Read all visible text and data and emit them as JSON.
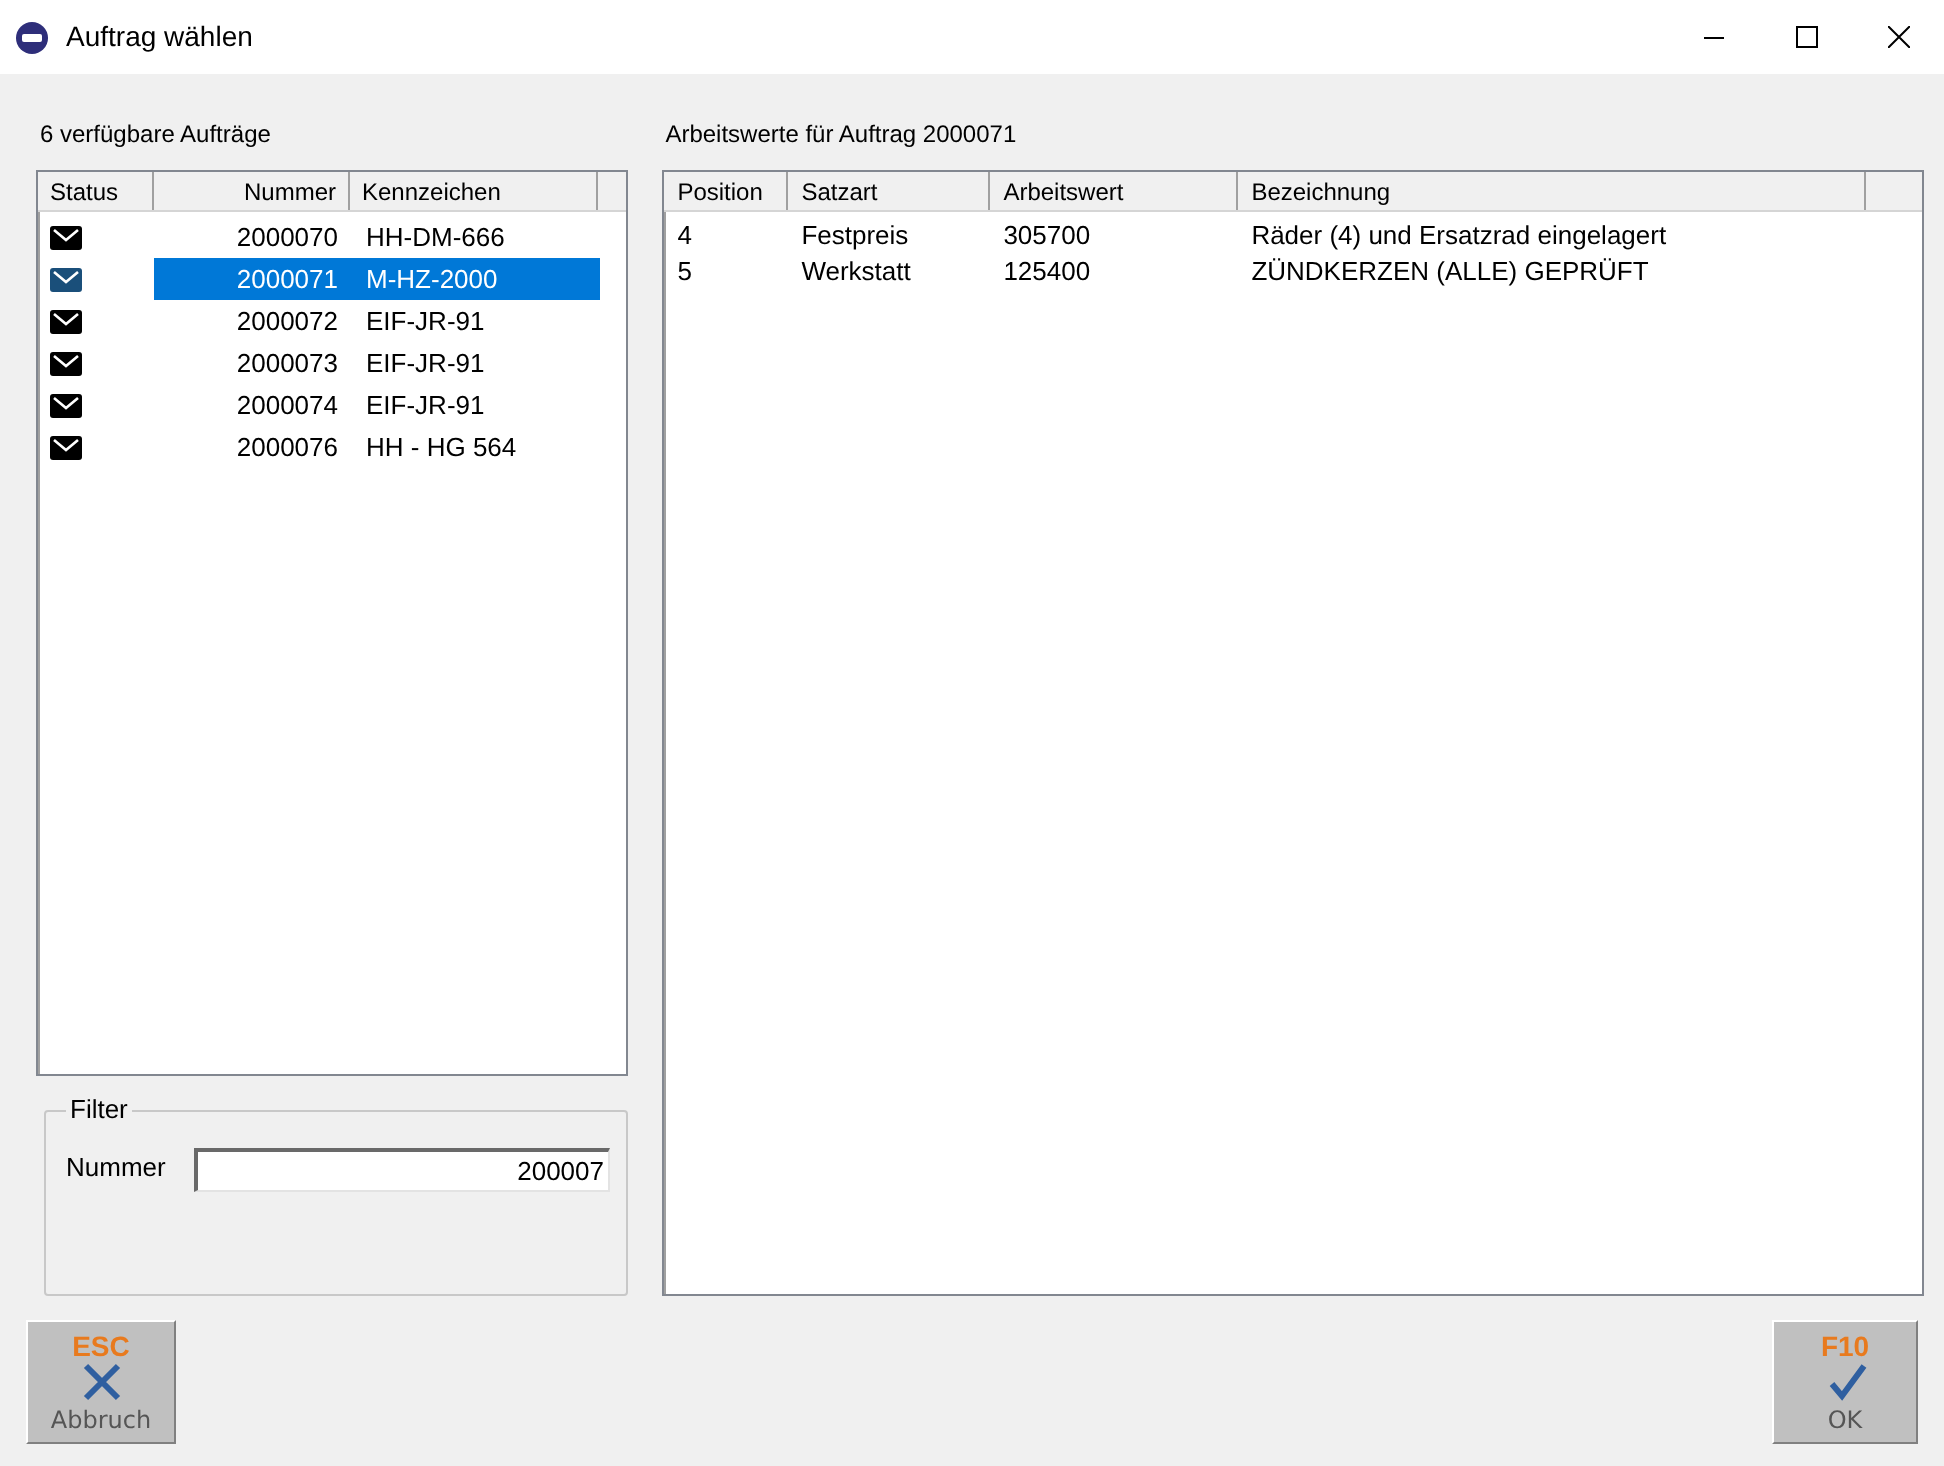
{
  "window": {
    "title": "Auftrag wählen"
  },
  "orders": {
    "heading": "6 verfügbare Aufträge",
    "columns": [
      "Status",
      "Nummer",
      "Kennzeichen"
    ],
    "rows": [
      {
        "kind": "mail",
        "nummer": "2000070",
        "kennzeichen": "HH-DM-666",
        "selected": false
      },
      {
        "kind": "mail",
        "nummer": "2000071",
        "kennzeichen": "M-HZ-2000",
        "selected": true
      },
      {
        "kind": "mail",
        "nummer": "2000072",
        "kennzeichen": "EIF-JR-91",
        "selected": false
      },
      {
        "kind": "mail",
        "nummer": "2000073",
        "kennzeichen": "EIF-JR-91",
        "selected": false
      },
      {
        "kind": "mail",
        "nummer": "2000074",
        "kennzeichen": "EIF-JR-91",
        "selected": false
      },
      {
        "kind": "mail",
        "nummer": "2000076",
        "kennzeichen": "HH - HG 564",
        "selected": false
      }
    ]
  },
  "filter": {
    "title": "Filter",
    "label": "Nummer",
    "value": "200007"
  },
  "work_values": {
    "heading": "Arbeitswerte für Auftrag 2000071",
    "columns": [
      "Position",
      "Satzart",
      "Arbeitswert",
      "Bezeichnung"
    ],
    "rows": [
      [
        "4",
        "Festpreis",
        "305700",
        "Räder (4) und Ersatzrad eingelagert"
      ],
      [
        "5",
        "Werkstatt",
        "125400",
        "ZÜNDKERZEN (ALLE) GEPRÜFT"
      ]
    ]
  },
  "buttons": [
    {
      "key": "ESC",
      "label": "Abbruch",
      "kind": "cancel"
    },
    {
      "key": "F10",
      "label": "OK",
      "kind": "ok"
    }
  ]
}
